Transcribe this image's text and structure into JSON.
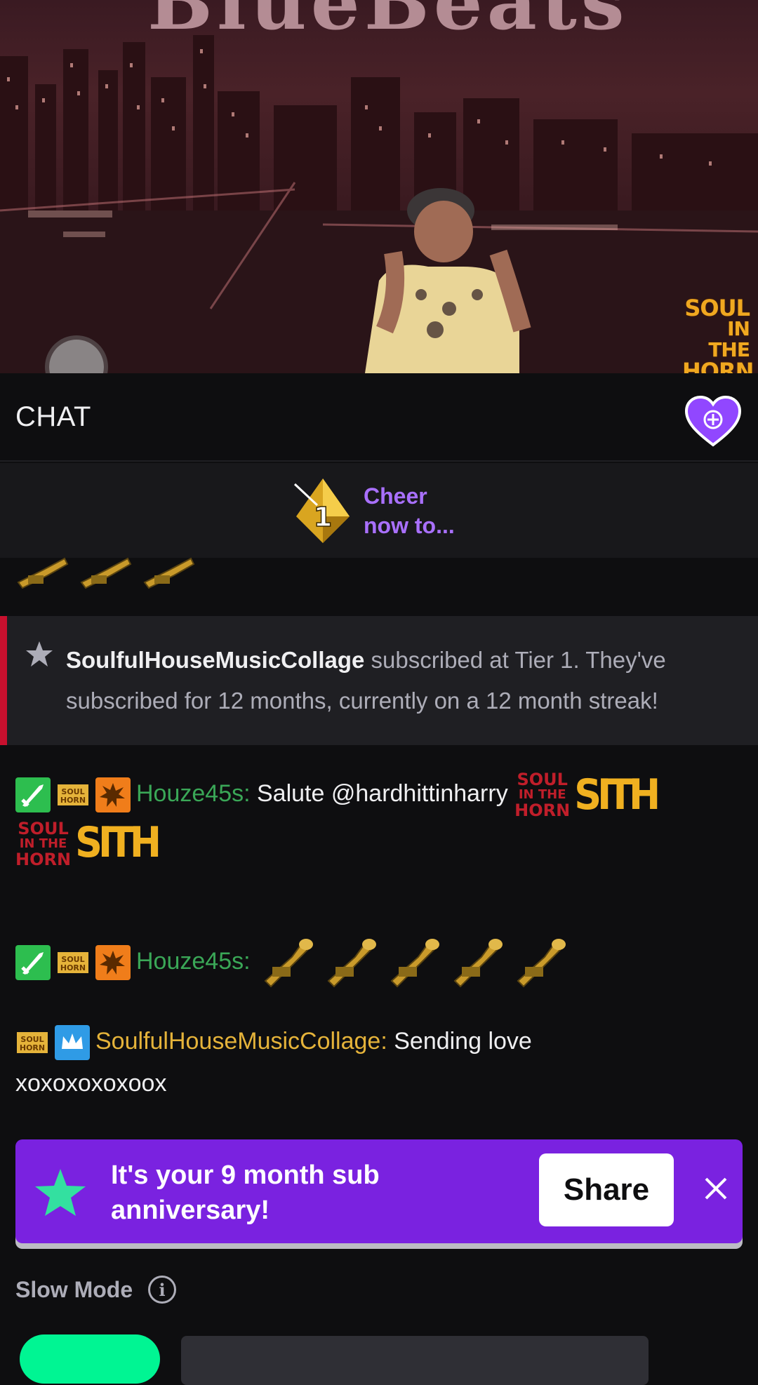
{
  "video": {
    "title_fragment": "BlueBeats",
    "logo_lines": [
      "SOUL",
      "IN THE",
      "HORN"
    ]
  },
  "chat": {
    "title": "CHAT"
  },
  "cheer": {
    "count": "1",
    "line1": "Cheer",
    "line2": "now to..."
  },
  "subscription_notice": {
    "username": "SoulfulHouseMusicCollage",
    "message": " subscribed at Tier 1. They've subscribed for 12 months, currently on a 12 month streak!"
  },
  "messages": [
    {
      "username": "Houze45s",
      "separator": ":",
      "text": " Salute @hardhittinharry"
    },
    {
      "username": "Houze45s",
      "separator": ":"
    },
    {
      "username": "SoulfulHouseMusicCollage",
      "separator": ":",
      "text": " Sending love",
      "text2": "xoxoxoxoxoox"
    }
  ],
  "emotes": {
    "soul_lines": [
      "SOUL",
      "IN THE",
      "HORN"
    ],
    "sith": "SITH",
    "badge_soul": "SOUL HORN"
  },
  "anniversary": {
    "line1": "It's your 9 month sub",
    "line2": "anniversary!",
    "share_label": "Share"
  },
  "footer": {
    "slow_mode_label": "Slow Mode",
    "info_glyph": "i"
  },
  "colors": {
    "accent_purple": "#a970ff",
    "banner_purple": "#7a22e0",
    "username_green": "#3aa757",
    "username_gold": "#e5b33a",
    "sub_stripe_red": "#c8102e",
    "chat_button_green": "#00f593"
  }
}
